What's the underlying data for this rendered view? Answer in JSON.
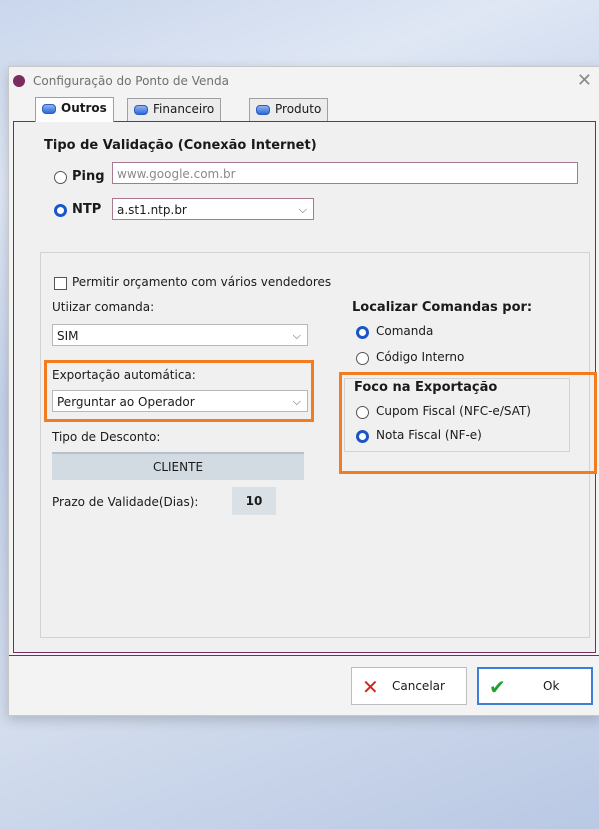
{
  "window": {
    "title": "Configuração do Ponto de Venda",
    "close_glyph": "✕"
  },
  "tabs": [
    {
      "label": "Outros",
      "icon": "blue-pill-icon",
      "active": true
    },
    {
      "label": "Financeiro",
      "icon": "blue-pill-icon",
      "active": false
    },
    {
      "label": "Produto",
      "icon": "blue-pill-icon",
      "active": false
    }
  ],
  "validation": {
    "title": "Tipo de Validação (Conexão Internet)",
    "ping_label": "Ping",
    "ping_value": "www.google.com.br",
    "ntp_label": "NTP",
    "ntp_value": "a.st1.ntp.br",
    "selected": "NTP"
  },
  "options": {
    "multi_sellers_label": "Permitir orçamento com vários vendedores",
    "multi_sellers_checked": false,
    "use_command_label": "Utiizar comanda:",
    "use_command_value": "SIM",
    "auto_export_label": "Exportação automática:",
    "auto_export_value": "Perguntar ao Operador",
    "discount_type_label": "Tipo de Desconto:",
    "discount_type_value": "CLIENTE",
    "validity_label": "Prazo de Validade(Dias):",
    "validity_value": "10"
  },
  "find_commands": {
    "title": "Localizar Comandas por:",
    "items": [
      "Comanda",
      "Código Interno"
    ],
    "selected": "Comanda"
  },
  "export_focus": {
    "title": "Foco na Exportação",
    "items": [
      "Cupom Fiscal (NFC-e/SAT)",
      "Nota Fiscal (NF-e)"
    ],
    "selected": "Nota Fiscal (NF-e)"
  },
  "buttons": {
    "cancel_label": "Cancelar",
    "ok_label": "Ok"
  },
  "colors": {
    "accent": "#7b2c5e",
    "highlight": "#f47c20",
    "radio_selected": "#1a56c8",
    "cancel_icon": "#d4241c",
    "ok_icon": "#23a034"
  }
}
